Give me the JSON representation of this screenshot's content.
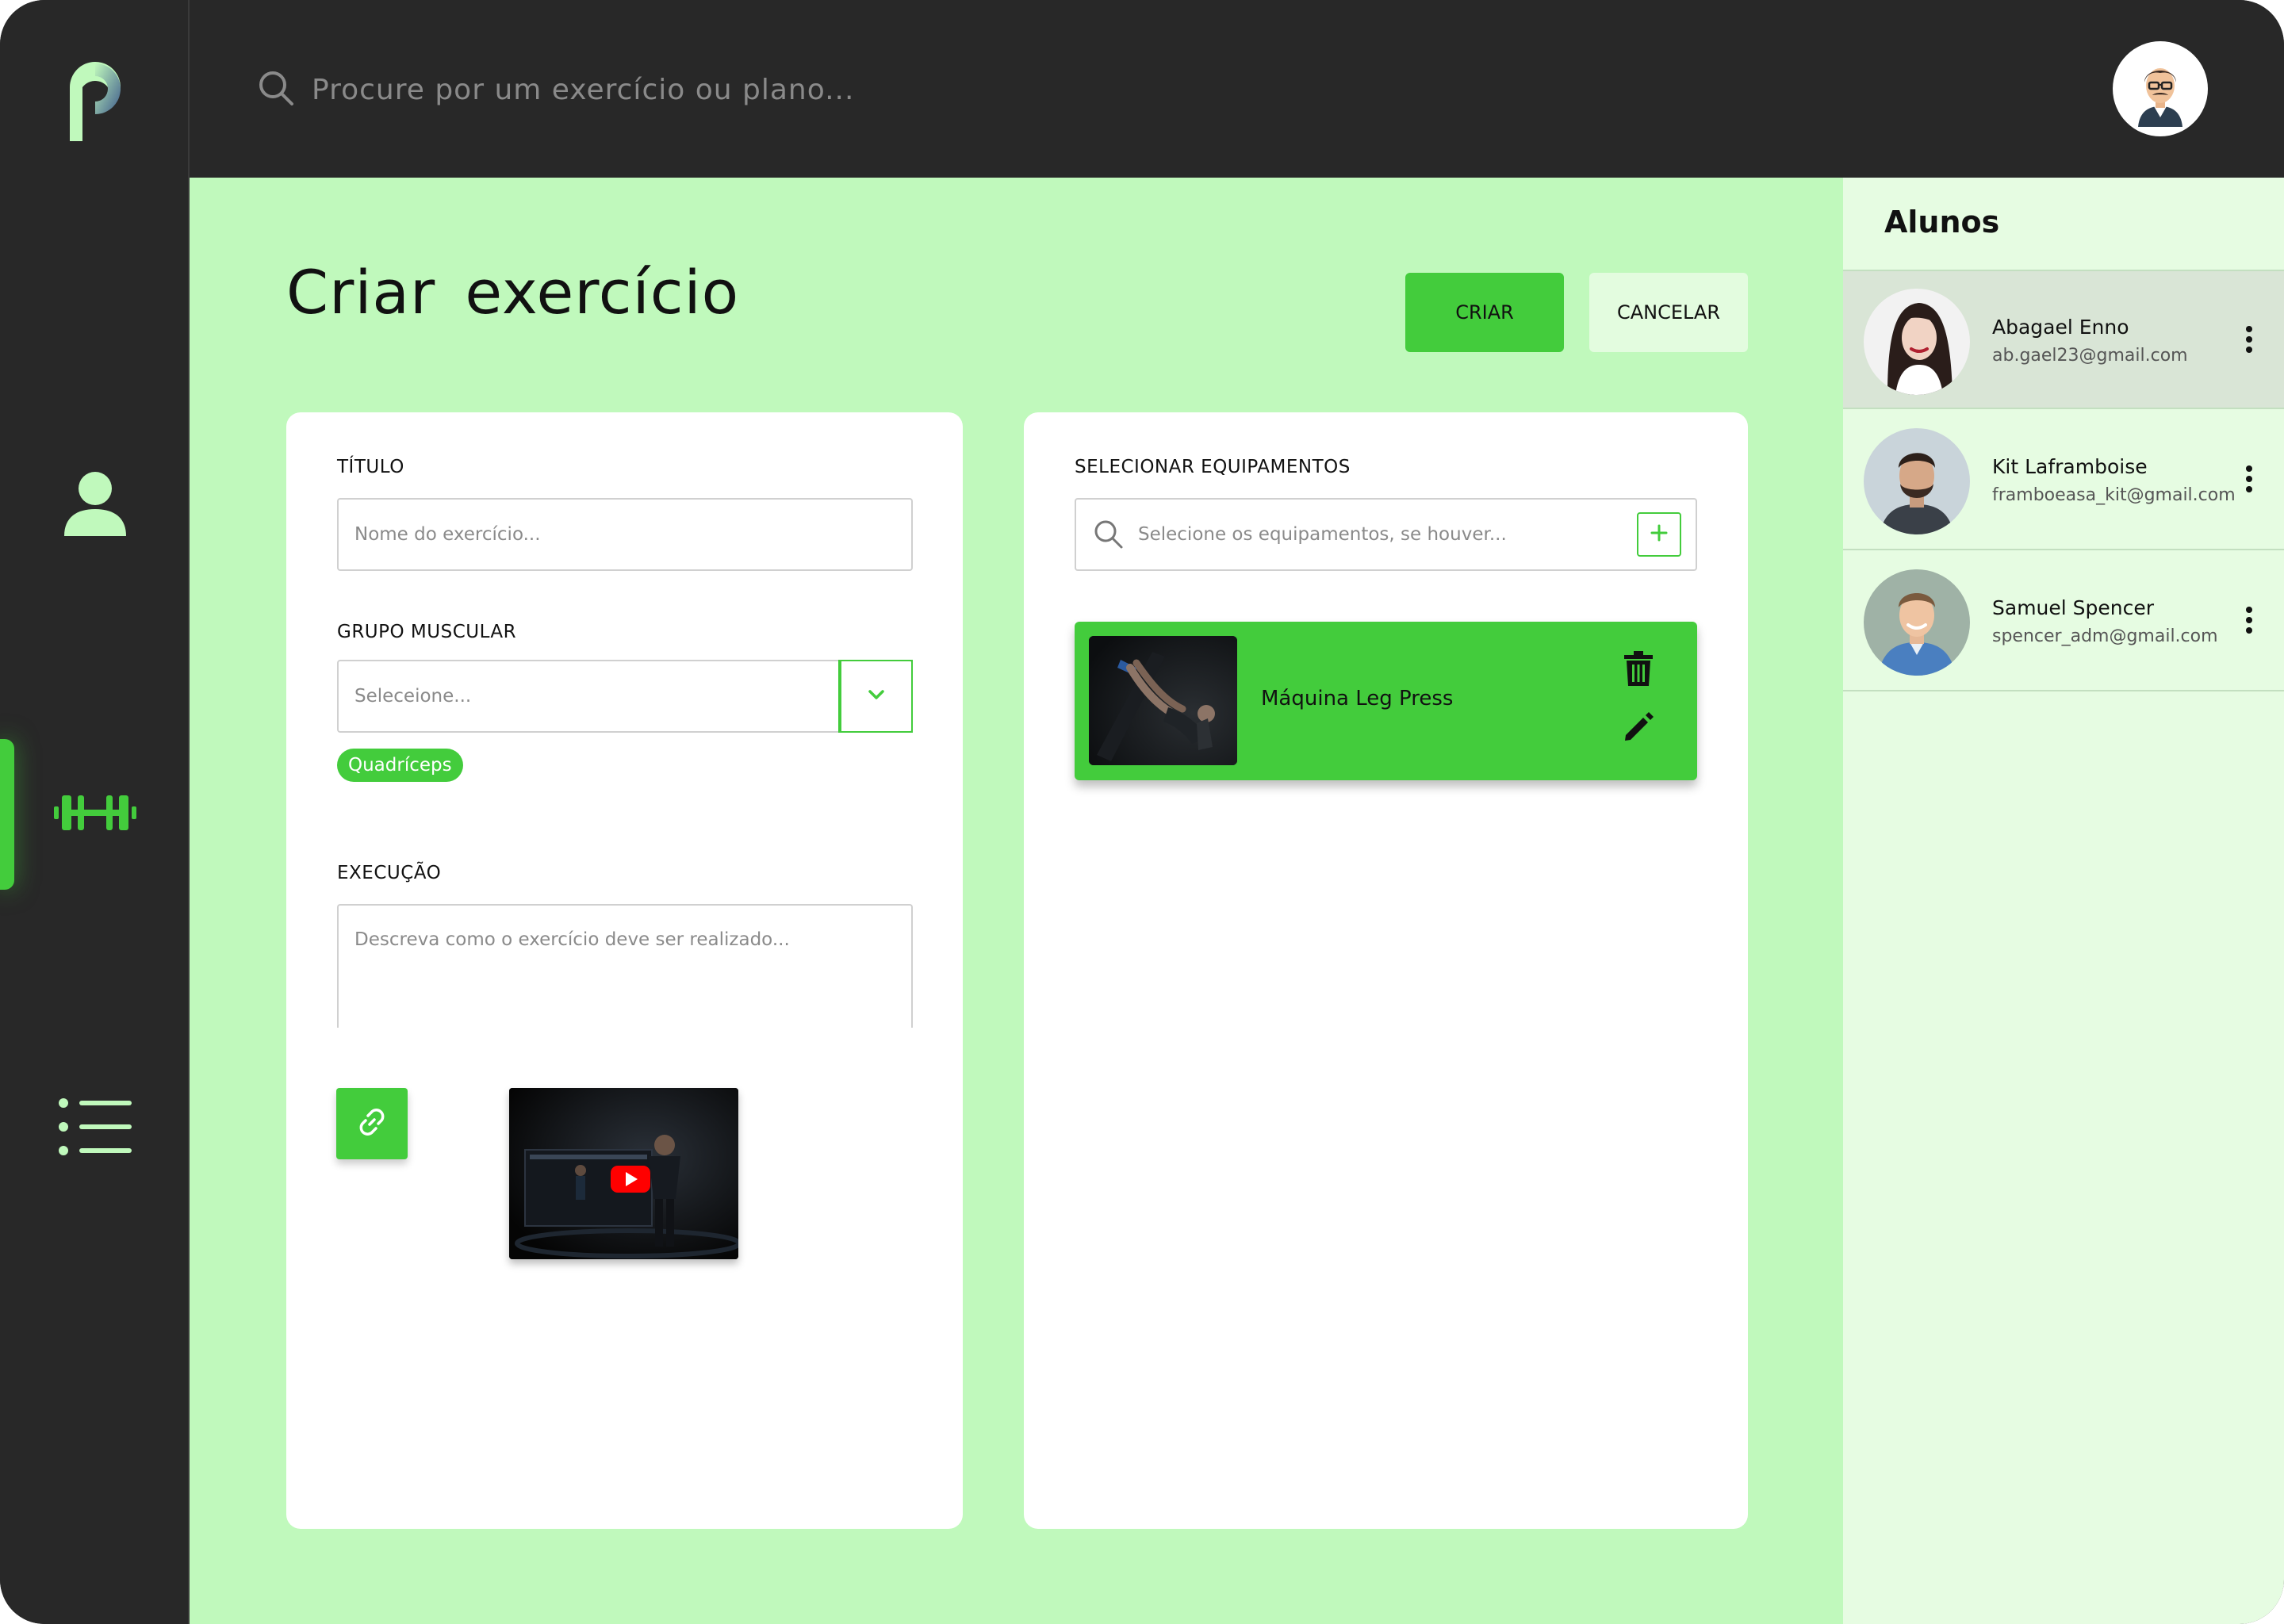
{
  "search": {
    "placeholder": "Procure por um exercício ou plano..."
  },
  "nav": {
    "items": [
      {
        "icon": "user-icon",
        "active": false
      },
      {
        "icon": "dumbbell-icon",
        "active": true
      },
      {
        "icon": "list-icon",
        "active": false
      }
    ]
  },
  "page": {
    "title": "Criar exercício",
    "create_label": "CRIAR",
    "cancel_label": "CANCELAR"
  },
  "form": {
    "title_label": "TÍTULO",
    "title_placeholder": "Nome do exercício...",
    "muscle_label": "GRUPO MUSCULAR",
    "muscle_placeholder": "Seleceione...",
    "muscle_tags": [
      "Quadríceps"
    ],
    "execution_label": "EXECUÇÃO",
    "execution_placeholder": "Descreva como o exercício deve ser realizado..."
  },
  "equipment": {
    "label": "SELECIONAR EQUIPAMENTOS",
    "search_placeholder": "Selecione os equipamentos, se houver...",
    "items": [
      {
        "name": "Máquina Leg Press"
      }
    ]
  },
  "students": {
    "title": "Alunos",
    "items": [
      {
        "name": "Abagael Enno",
        "email": "ab.gael23@gmail.com",
        "selected": true
      },
      {
        "name": "Kit Laframboise",
        "email": "framboeasa_kit@gmail.com",
        "selected": false
      },
      {
        "name": "Samuel Spencer",
        "email": "spencer_adm@gmail.com",
        "selected": false
      }
    ]
  },
  "colors": {
    "accent": "#43cc3c",
    "dark": "#282828",
    "main_bg": "#c0f9bc",
    "panel_bg": "#e6fce2",
    "nav_icon": "#c0f9bc"
  }
}
